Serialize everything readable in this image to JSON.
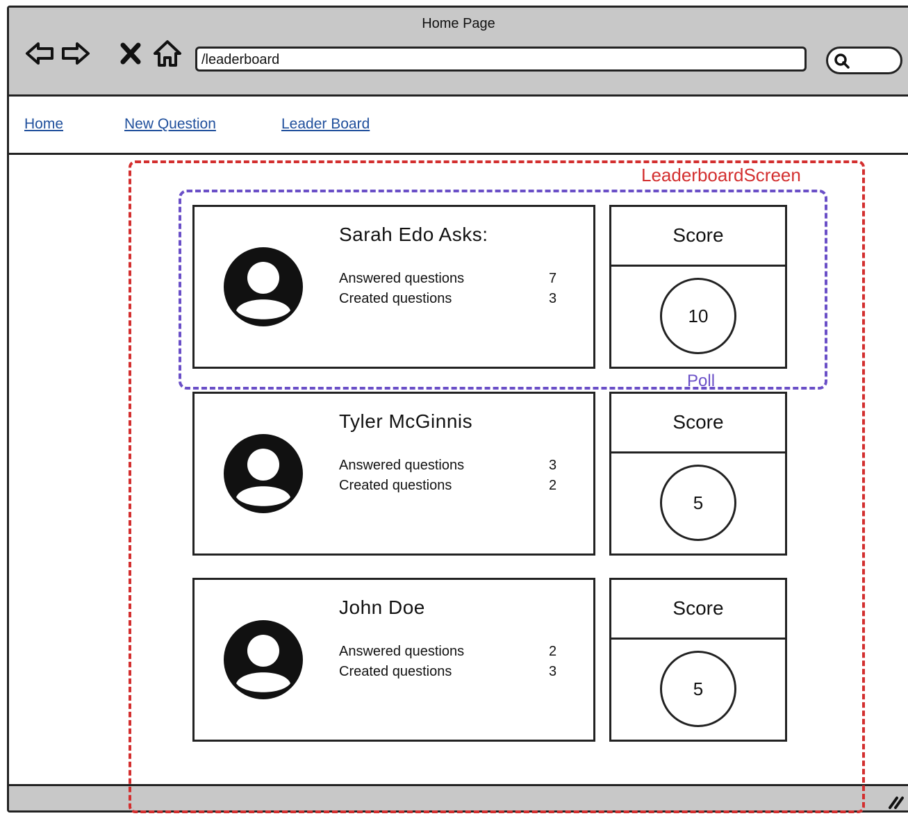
{
  "browser": {
    "title": "Home Page",
    "url": "/leaderboard"
  },
  "nav": {
    "home": "Home",
    "new_question": "New Question",
    "leader_board": "Leader Board"
  },
  "annotations": {
    "screen_label": "LeaderboardScreen",
    "poll_label": "Poll"
  },
  "leaderboard": [
    {
      "name": "Sarah Edo Asks:",
      "answered_label": "Answered questions",
      "answered": "7",
      "created_label": "Created questions",
      "created": "3",
      "score_label": "Score",
      "score": "10"
    },
    {
      "name": "Tyler McGinnis",
      "answered_label": "Answered questions",
      "answered": "3",
      "created_label": "Created questions",
      "created": "2",
      "score_label": "Score",
      "score": "5"
    },
    {
      "name": "John Doe",
      "answered_label": "Answered questions",
      "answered": "2",
      "created_label": "Created questions",
      "created": "3",
      "score_label": "Score",
      "score": "5"
    }
  ],
  "colors": {
    "screen_annotation": "#d32f2f",
    "poll_annotation": "#6a4fc7",
    "link": "#1f4f9c",
    "chrome": "#c8c8c8"
  }
}
